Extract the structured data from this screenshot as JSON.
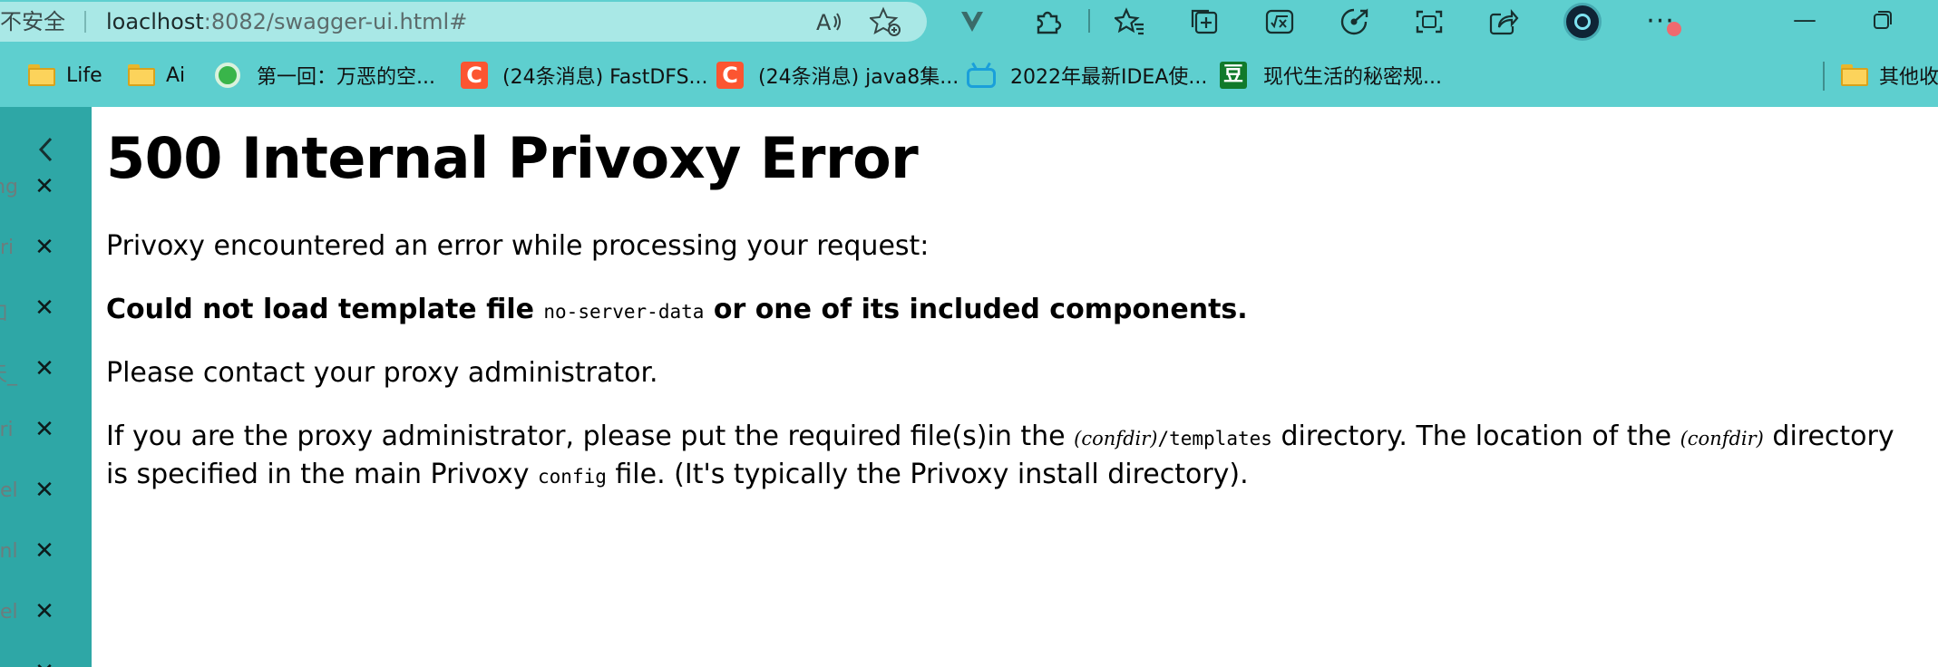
{
  "browser": {
    "security_label": "不安全",
    "url_host": "loaclhost",
    "url_rest": ":8082/swagger-ui.html#",
    "toolbar_icons": [
      "read-aloud-icon",
      "add-favorite-icon",
      "extension-v-icon",
      "extensions-icon",
      "favorites-icon",
      "collections-icon",
      "math-solver-icon",
      "web-capture-icon",
      "screenshot-icon",
      "share-icon",
      "profile-icon",
      "more-icon"
    ],
    "window_controls": [
      "minimize",
      "maximize"
    ]
  },
  "bookmarks": [
    {
      "label": "Life",
      "icon": "folder-icon"
    },
    {
      "label": "Ai",
      "icon": "folder-icon"
    },
    {
      "label": "第一回：万恶的空...",
      "icon": "green-circle-icon"
    },
    {
      "label": "(24条消息) FastDFS...",
      "icon": "csdn-icon"
    },
    {
      "label": "(24条消息) java8集...",
      "icon": "csdn-icon"
    },
    {
      "label": "2022年最新IDEA使...",
      "icon": "bilibili-icon"
    },
    {
      "label": "现代生活的秘密规...",
      "icon": "douban-icon"
    },
    {
      "label": "其他收",
      "icon": "folder-icon"
    }
  ],
  "sidebar": {
    "tab_fragments": [
      "ing",
      "pri",
      "如",
      "天_",
      "ori",
      "del",
      "enl",
      "del",
      ""
    ]
  },
  "page": {
    "title": "500 Internal Privoxy Error",
    "intro": "Privoxy encountered an error while processing your request:",
    "error_prefix": "Could not load template file ",
    "error_file": "no-server-data",
    "error_suffix": " or one of its included components.",
    "contact": "Please contact your proxy administrator.",
    "admin_text_1": "If you are the proxy administrator, please put the required file(s)in the ",
    "confdir": "(confdir)",
    "templates_path": "/templates",
    "admin_text_2": " directory. The location of the ",
    "admin_text_3": " directory is specified in the main Privoxy ",
    "config_file": "config",
    "admin_text_4": " file. (It's typically the Privoxy install directory)."
  }
}
